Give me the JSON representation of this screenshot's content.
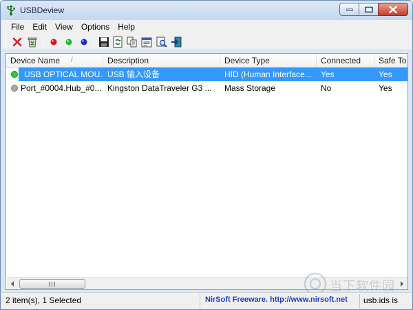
{
  "window": {
    "title": "USBDeview"
  },
  "menu": [
    "File",
    "Edit",
    "View",
    "Options",
    "Help"
  ],
  "toolbar": {
    "icons": [
      "uninstall-x-icon",
      "recycle-device-icon",
      "red-dot-icon",
      "green-dot-icon",
      "blue-dot-icon",
      "save-icon",
      "refresh-icon",
      "copy-icon",
      "properties-icon",
      "find-icon",
      "exit-icon"
    ]
  },
  "columns": [
    "Device Name",
    "Description",
    "Device Type",
    "Connected",
    "Safe To"
  ],
  "sort_indicator": "/",
  "rows": [
    {
      "status_color": "#2ecc40",
      "device_name": "USB OPTICAL MOU...",
      "description": "USB 输入设备",
      "device_type": "HID (Human Interface...",
      "connected": "Yes",
      "safe": "Yes",
      "selected": true
    },
    {
      "status_color": "#9a9a9a",
      "device_name": "Port_#0004.Hub_#0...",
      "description": "Kingston DataTraveler G3 ...",
      "device_type": "Mass Storage",
      "connected": "No",
      "safe": "Yes",
      "selected": false
    }
  ],
  "statusbar": {
    "items_text": "2 item(s), 1 Selected",
    "link_text": "NirSoft Freeware.  http://www.nirsoft.net",
    "right_text": "usb.ids is"
  },
  "watermark": {
    "text": "当下软件园"
  },
  "colors": {
    "selection": "#3399ff",
    "link": "#1a3fc4",
    "status_ok": "#2ecc40",
    "status_off": "#9a9a9a"
  }
}
